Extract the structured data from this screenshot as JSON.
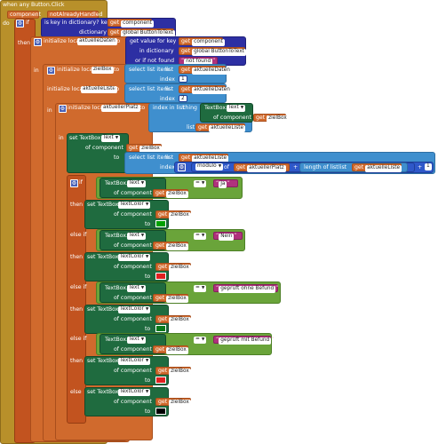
{
  "event": {
    "title": "when any Button.Click",
    "param1": "component",
    "param2": "notAlreadyHandled",
    "do": "do",
    "if": "if",
    "then": "then",
    "in": "in"
  },
  "dict": {
    "key_check": "is key in dictionary? key",
    "dictionary": "dictionary",
    "get": "get",
    "component": "component",
    "global_btn": "global ButtonToText",
    "get_value": "get value for key",
    "in_dictionary": "in dictionary",
    "or_not_found": "or if not found",
    "not_found": "not found"
  },
  "vars": {
    "init_local": "initialize local",
    "var1": "aktuelleDaten",
    "to": "to",
    "var2": "zielBox",
    "var3": "aktuelleListe",
    "var4": "aktuellerPlatz"
  },
  "list": {
    "select_item": "select list item",
    "list": "list",
    "index": "index",
    "index1": "1",
    "index2": "2",
    "index_in_list": "index in list",
    "thing": "thing",
    "length_of_list": "length of list",
    "list_kw": "list"
  },
  "textbox": {
    "set": "set TextBox.",
    "text": "Text",
    "text_color": "TextColor",
    "of_component": "of component",
    "to": "to",
    "textbox_get": "TextBox."
  },
  "math": {
    "modulo": "modulo",
    "of": "of",
    "plus": "+",
    "one": "1",
    "equals": "="
  },
  "branches": {
    "if": "if",
    "then": "then",
    "else_if": "else if",
    "else": "else"
  },
  "strings": {
    "ja": "Ja",
    "nein": "Nein",
    "ohne": "geprüft ohne Befund",
    "mit": "geprüft mit Befund"
  },
  "colors": {
    "event": "#b8902a",
    "var": "#d06a2d",
    "dict": "#2d2fa3",
    "list": "#3f8fce",
    "component": "#1f6b3f",
    "logic": "#6aa43a",
    "math": "#2f58c9",
    "text": "#b0327d",
    "green": "#00a000",
    "red": "#e02020",
    "dark_green": "#0a7a1a",
    "black": "#000000"
  }
}
